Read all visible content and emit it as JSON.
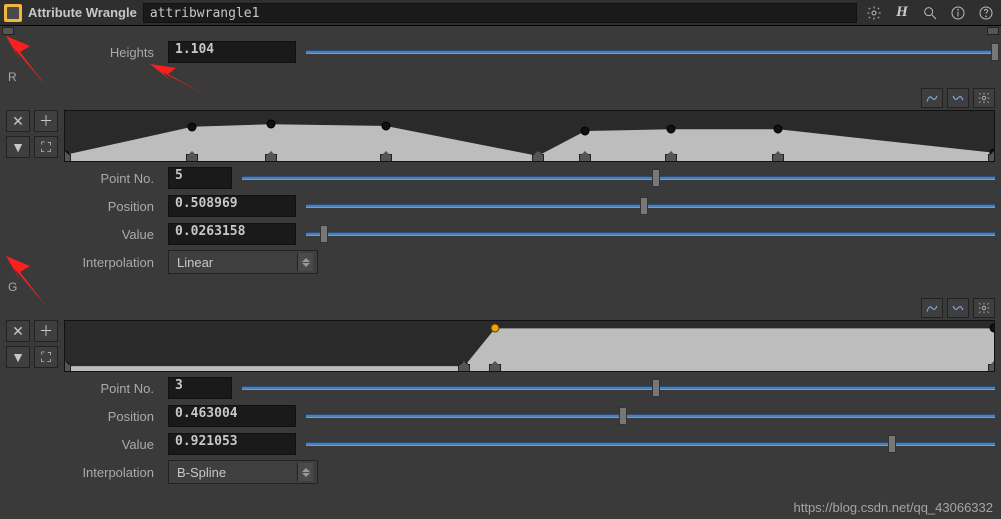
{
  "header": {
    "node_type": "Attribute Wrangle",
    "node_name": "attribwrangle1"
  },
  "heights": {
    "label": "Heights",
    "value": "1.104",
    "slider_pos": 100
  },
  "channel_R": {
    "label": "R"
  },
  "channel_G": {
    "label": "G"
  },
  "rampR": {
    "pointno": {
      "label": "Point No.",
      "value": "5",
      "slider_pos": 55
    },
    "position": {
      "label": "Position",
      "value": "0.508969",
      "slider_pos": 49
    },
    "value": {
      "label": "Value",
      "value": "0.0263158",
      "slider_pos": 2.6
    },
    "interp": {
      "label": "Interpolation",
      "value": "Linear"
    },
    "points": [
      {
        "x": 0.0,
        "y": 0.05
      },
      {
        "x": 0.137,
        "y": 0.72
      },
      {
        "x": 0.222,
        "y": 0.78
      },
      {
        "x": 0.345,
        "y": 0.74
      },
      {
        "x": 0.509,
        "y": 0.026,
        "selected": true
      },
      {
        "x": 0.56,
        "y": 0.62
      },
      {
        "x": 0.652,
        "y": 0.66
      },
      {
        "x": 0.768,
        "y": 0.66
      },
      {
        "x": 1.0,
        "y": 0.1
      }
    ]
  },
  "rampG": {
    "pointno": {
      "label": "Point No.",
      "value": "3",
      "slider_pos": 55
    },
    "position": {
      "label": "Position",
      "value": "0.463004",
      "slider_pos": 46
    },
    "value": {
      "label": "Value",
      "value": "0.921053",
      "slider_pos": 85
    },
    "interp": {
      "label": "Interpolation",
      "value": "B-Spline"
    },
    "points": [
      {
        "x": 0.0,
        "y": 0.02
      },
      {
        "x": 0.43,
        "y": 0.02
      },
      {
        "x": 0.463,
        "y": 0.92,
        "selected": true
      },
      {
        "x": 1.0,
        "y": 0.92
      }
    ]
  },
  "watermark": "https://blog.csdn.net/qq_43066332",
  "chart_data": [
    {
      "type": "line",
      "title": "Ramp R",
      "xlabel": "Position",
      "ylabel": "Value",
      "xlim": [
        0,
        1
      ],
      "ylim": [
        0,
        1
      ],
      "x": [
        0.0,
        0.137,
        0.222,
        0.345,
        0.509,
        0.56,
        0.652,
        0.768,
        1.0
      ],
      "y": [
        0.05,
        0.72,
        0.78,
        0.74,
        0.026,
        0.62,
        0.66,
        0.66,
        0.1
      ],
      "selected_index": 4
    },
    {
      "type": "line",
      "title": "Ramp G",
      "xlabel": "Position",
      "ylabel": "Value",
      "xlim": [
        0,
        1
      ],
      "ylim": [
        0,
        1
      ],
      "x": [
        0.0,
        0.43,
        0.463,
        1.0
      ],
      "y": [
        0.02,
        0.02,
        0.92,
        0.92
      ],
      "selected_index": 2
    }
  ]
}
